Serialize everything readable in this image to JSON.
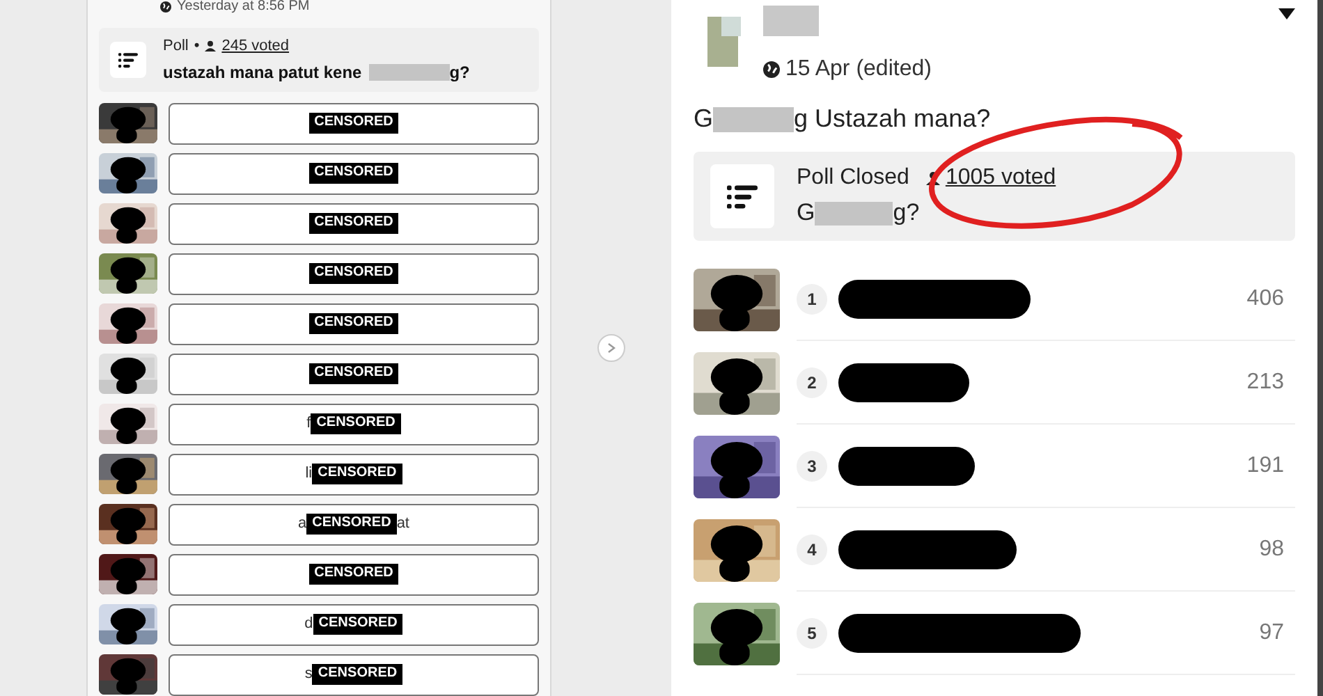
{
  "left_post": {
    "timestamp": "Yesterday at 8:56 PM",
    "poll": {
      "label": "Poll",
      "separator": "•",
      "votes": "245 voted",
      "question_start": "ustazah mana patut kene",
      "question_end": "g?"
    },
    "options": [
      {
        "censor": "CENSORED"
      },
      {
        "censor": "CENSORED"
      },
      {
        "censor": "CENSORED"
      },
      {
        "censor": "CENSORED"
      },
      {
        "censor": "CENSORED"
      },
      {
        "censor": "CENSORED"
      },
      {
        "prefix": "f",
        "censor": "CENSORED"
      },
      {
        "prefix": "li",
        "censor": "CENSORED"
      },
      {
        "prefix": "a",
        "censor": "CENSORED",
        "suffix": "at"
      },
      {
        "censor": "CENSORED"
      },
      {
        "prefix": "d",
        "censor": "CENSORED"
      },
      {
        "prefix": "s",
        "censor": "CENSORED"
      }
    ]
  },
  "right_post": {
    "timestamp": "15 Apr (edited)",
    "text_start": "G",
    "text_end": "g Ustazah mana?",
    "poll": {
      "label": "Poll Closed",
      "votes": "1005 voted",
      "question_start": "G",
      "question_end": "g?"
    },
    "results": [
      {
        "rank": "1",
        "count": "406"
      },
      {
        "rank": "2",
        "count": "213"
      },
      {
        "rank": "3",
        "count": "191"
      },
      {
        "rank": "4",
        "count": "98"
      },
      {
        "rank": "5",
        "count": "97"
      }
    ]
  }
}
